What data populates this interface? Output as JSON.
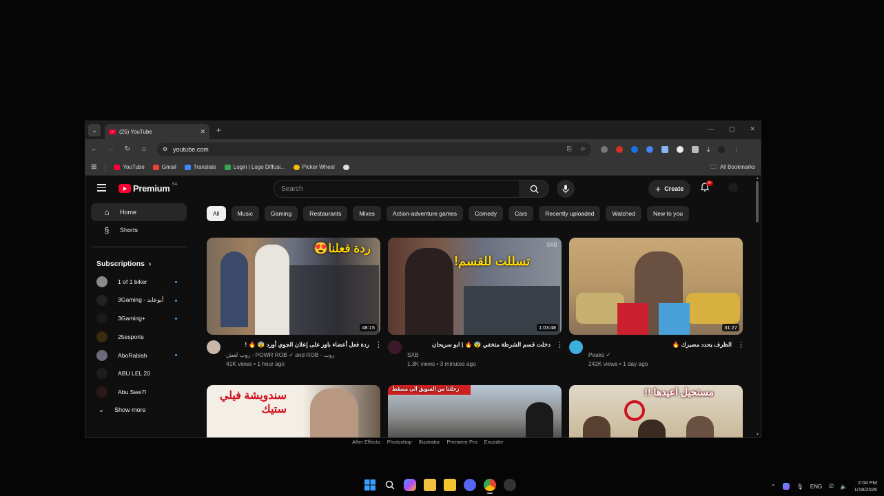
{
  "browser": {
    "tab_title": "(25) YouTube",
    "url": "youtube.com",
    "bookmarks": [
      {
        "label": "YouTube",
        "color": "#ff0033"
      },
      {
        "label": "Gmail",
        "color": "#ea4335"
      },
      {
        "label": "Translate",
        "color": "#4285f4"
      },
      {
        "label": "Login | Logo Diffusi...",
        "color": "#34a853"
      },
      {
        "label": "Picker Wheel",
        "color": "#fbbc04"
      }
    ],
    "all_bookmarks": "All Bookmarks"
  },
  "youtube": {
    "logo_text": "Premium",
    "logo_region": "SA",
    "search_placeholder": "Search",
    "create_label": "Create",
    "notifications_badge": "9+",
    "sidebar": {
      "home": "Home",
      "shorts": "Shorts",
      "subscriptions_title": "Subscriptions",
      "subscriptions": [
        {
          "name": "1 of 1 biker",
          "new": true,
          "color": "#8a8a8a"
        },
        {
          "name": "3Gaming - أبوعابد",
          "new": true,
          "color": "#222222"
        },
        {
          "name": "3Gaming+",
          "new": true,
          "color": "#1a1a1a"
        },
        {
          "name": "25esports",
          "new": false,
          "color": "#3a2a10"
        },
        {
          "name": "AboRabiah",
          "new": true,
          "color": "#6a6a7a"
        },
        {
          "name": "ABU LEL 20",
          "new": false,
          "color": "#1d1d1d"
        },
        {
          "name": "Abu Swe7l",
          "new": false,
          "color": "#2a1a1a"
        }
      ],
      "show_more": "Show more"
    },
    "chips": [
      "All",
      "Music",
      "Gaming",
      "Restaurants",
      "Mixes",
      "Action-adventure games",
      "Comedy",
      "Cars",
      "Recently uploaded",
      "Watched",
      "New to you"
    ],
    "videos": [
      {
        "title": "ردة فعل أعضاء باور على إعلان الجوي أورد 😨 🔥 ! ",
        "channel": "روب لعش - POWR ROB ✓ and ROB - روب",
        "stats": "41K views • 1 hour ago",
        "duration": "48:15",
        "overlay": "ردة فعلنا😍"
      },
      {
        "title": "دخلت قسم الشرطة متخفي 😨 🔥 | ابو سريحان",
        "channel": "SXB",
        "stats": "1.3K views • 3 minutes ago",
        "duration": "1:03:48",
        "overlay": "تسللت للقسم!",
        "watermark": "SXB"
      },
      {
        "title": "الظرف يحدد مصيرك 🔥",
        "channel": "Peaks ✓",
        "stats": "242K views • 1 day ago",
        "duration": "31:27"
      }
    ],
    "videos_row2": [
      {
        "overlay": "سندويشة فيلي ستيك"
      },
      {
        "overlay": "رحلتنا من السويق الى مسقط"
      },
      {
        "overlay": "مستحيل اعيدها !!"
      }
    ]
  },
  "below_window": [
    "After Effects",
    "Photoshop",
    "Illustrator",
    "Premiere Pro",
    "Encoder"
  ],
  "taskbar": {
    "language": "ENG",
    "time": "2:04 PM",
    "date": "1/18/2026"
  }
}
